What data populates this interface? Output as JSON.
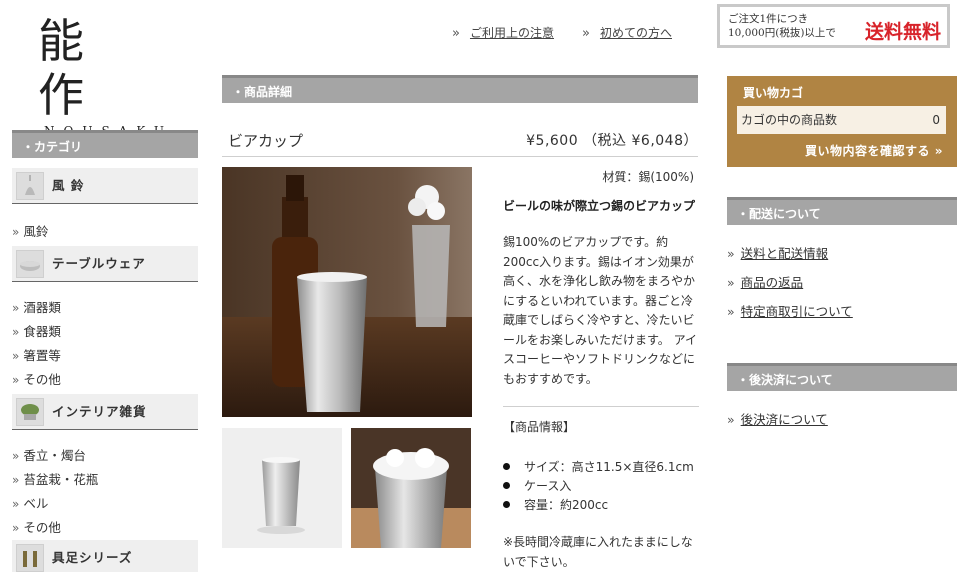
{
  "logo": {
    "kanji": "能 作",
    "roman": "NOUSAKU"
  },
  "header": {
    "links": [
      {
        "label": "ご利用上の注意"
      },
      {
        "label": "初めての方へ"
      }
    ],
    "shipping": {
      "line1": "ご注文1件につき",
      "line2": "10,000円(税抜)以上で",
      "highlight": "送料無料",
      "highlight_color": "#d8232a"
    }
  },
  "sidebar": {
    "header": "・カテゴリ",
    "groups": [
      {
        "title": "風 鈴",
        "items": [
          "風鈴"
        ]
      },
      {
        "title": "テーブルウェア",
        "items": [
          "酒器類",
          "食器類",
          "箸置等",
          "その他"
        ]
      },
      {
        "title": "インテリア雑貨",
        "items": [
          "香立・燭台",
          "苔盆栽・花瓶",
          "ベル",
          "その他"
        ]
      },
      {
        "title": "具足シリーズ",
        "items": []
      }
    ]
  },
  "main": {
    "section_title": "・商品詳細",
    "product": {
      "name": "ビアカップ",
      "price": "¥5,600 （税込 ¥6,048）",
      "material": "材質：錫(100%)",
      "catch_copy": "ビールの味が際立つ錫のビアカップ",
      "description": "錫100%のビアカップです。約200cc入ります。錫はイオン効果が高く、水を浄化し飲み物をまろやかにするといわれています。器ごと冷蔵庫でしばらく冷やすと、冷たいビールをお楽しみいただけます。 アイスコーヒーやソフトドリンクなどにもおすすめです。",
      "info_header": "【商品情報】",
      "specs": [
        "サイズ：高さ11.5×直径6.1cm",
        "ケース入",
        "容量：約200cc"
      ],
      "note": "※長時間冷蔵庫に入れたままにしないで下さい。"
    }
  },
  "cart": {
    "title": "買い物カゴ",
    "row_label": "カゴの中の商品数",
    "count": "0",
    "check_label": "買い物内容を確認する",
    "bg_color": "#b08443"
  },
  "right": {
    "shipping_header": "・配送について",
    "shipping_links": [
      "送料と配送情報",
      "商品の返品",
      "特定商取引について"
    ],
    "postpay_header": "・後決済について",
    "postpay_links": [
      "後決済について"
    ]
  },
  "icons": [
    "double-chevron-right-icon",
    "bullet-dot-icon"
  ]
}
